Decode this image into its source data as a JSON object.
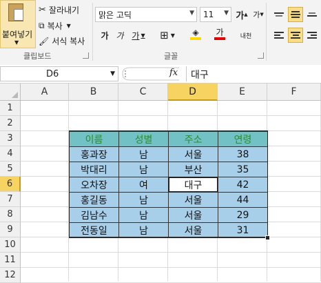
{
  "clipboard": {
    "paste_label": "붙여넣기",
    "cut_label": "잘라내기",
    "copy_label": "복사",
    "format_painter_label": "서식 복사",
    "group_label": "클립보드"
  },
  "font": {
    "font_name": "맑은 고딕",
    "font_size": "11",
    "grow_label": "가",
    "shrink_label": "가",
    "bold_label": "가",
    "italic_label": "가",
    "underline_label": "가",
    "font_color_label": "가",
    "phonetic_label": "내천",
    "group_label": "글꼴",
    "fill_color": "#ffd800",
    "font_color": "#e00000"
  },
  "formula_bar": {
    "name_box": "D6",
    "fx_label": "fx",
    "formula": "대구"
  },
  "sheet": {
    "columns": [
      "A",
      "B",
      "C",
      "D",
      "E",
      "F"
    ],
    "rows": [
      "1",
      "2",
      "3",
      "4",
      "5",
      "6",
      "7",
      "8",
      "9",
      "10",
      "11",
      "12"
    ],
    "selected_column": "D",
    "selected_row": "6",
    "table_headers": [
      "이름",
      "성별",
      "주소",
      "연령"
    ],
    "table_rows": [
      [
        "홍과장",
        "남",
        "서울",
        "38"
      ],
      [
        "박대리",
        "남",
        "부산",
        "35"
      ],
      [
        "오차장",
        "여",
        "대구",
        "42"
      ],
      [
        "홍길동",
        "남",
        "서울",
        "44"
      ],
      [
        "김남수",
        "남",
        "서울",
        "29"
      ],
      [
        "전동일",
        "남",
        "서울",
        "31"
      ]
    ],
    "header_fill": "#72c1c4",
    "data_fill": "#a7cfea",
    "selection_color": "#f7d462"
  }
}
